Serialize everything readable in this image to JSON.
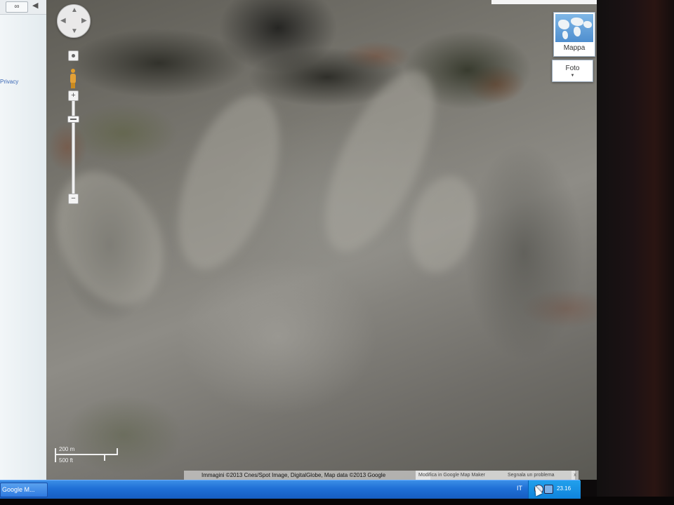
{
  "sidebar": {
    "link_icon": "link-icon",
    "link_symbol": "∞",
    "collapse_symbol": "◀",
    "privacy_label": "Privacy"
  },
  "map": {
    "pan_icon": "pan-control-icon",
    "pan_up": "▲",
    "pan_down": "▼",
    "pan_left": "◀",
    "pan_right": "▶",
    "zoom_in_label": "+",
    "zoom_out_label": "−",
    "map_type_label": "Mappa",
    "photo_type_label": "Foto",
    "photo_chevron": "▼",
    "scale_top": "200 m",
    "scale_bottom": "500 ft",
    "attribution": "Immagini ©2013 Cnes/Spot Image, DigitalGlobe, Map data ©2013 Google",
    "map_maker_link": "Modifica in Google Map Maker",
    "report_link": "Segnala un problema",
    "close_symbol": "x"
  },
  "taskbar": {
    "window_item": "Google M...",
    "language": "IT",
    "clock": "23.16"
  },
  "colors": {
    "taskbar": "#1f6fd6",
    "tray": "#0f83dc",
    "privacy_link": "#3a67b5"
  }
}
